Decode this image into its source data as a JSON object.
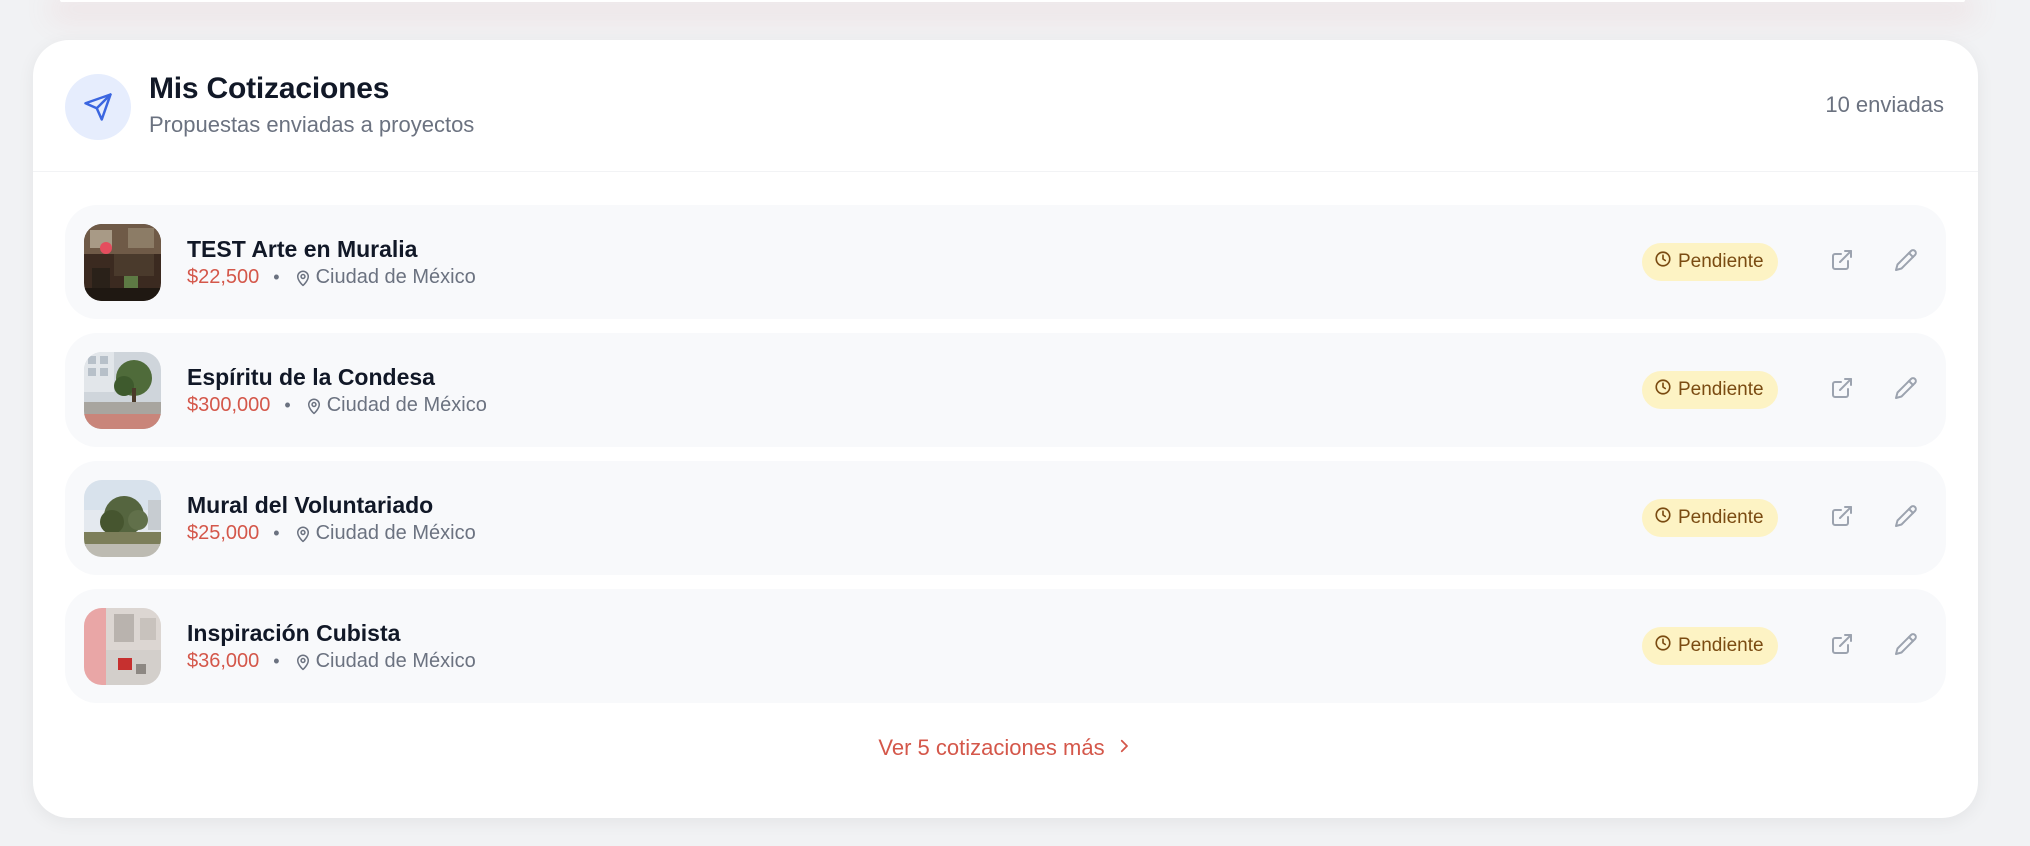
{
  "header": {
    "title": "Mis Cotizaciones",
    "subtitle": "Propuestas enviadas a proyectos",
    "count": "10 enviadas",
    "icon": "send-icon"
  },
  "quotes": [
    {
      "title": "TEST Arte en Muralia",
      "price": "$22,500",
      "separator": "•",
      "location": "Ciudad de México",
      "status": "Pendiente"
    },
    {
      "title": "Espíritu de la Condesa",
      "price": "$300,000",
      "separator": "•",
      "location": "Ciudad de México",
      "status": "Pendiente"
    },
    {
      "title": "Mural del Voluntariado",
      "price": "$25,000",
      "separator": "•",
      "location": "Ciudad de México",
      "status": "Pendiente"
    },
    {
      "title": "Inspiración Cubista",
      "price": "$36,000",
      "separator": "•",
      "location": "Ciudad de México",
      "status": "Pendiente"
    }
  ],
  "more_link": {
    "label": "Ver 5 cotizaciones más"
  },
  "colors": {
    "accent": "#d4574a",
    "header_icon_bg": "#e6edfd",
    "header_icon": "#3b66e0",
    "status_bg": "#fdf3c4",
    "status_text": "#7a4b12",
    "row_bg": "#f8f9fb"
  }
}
